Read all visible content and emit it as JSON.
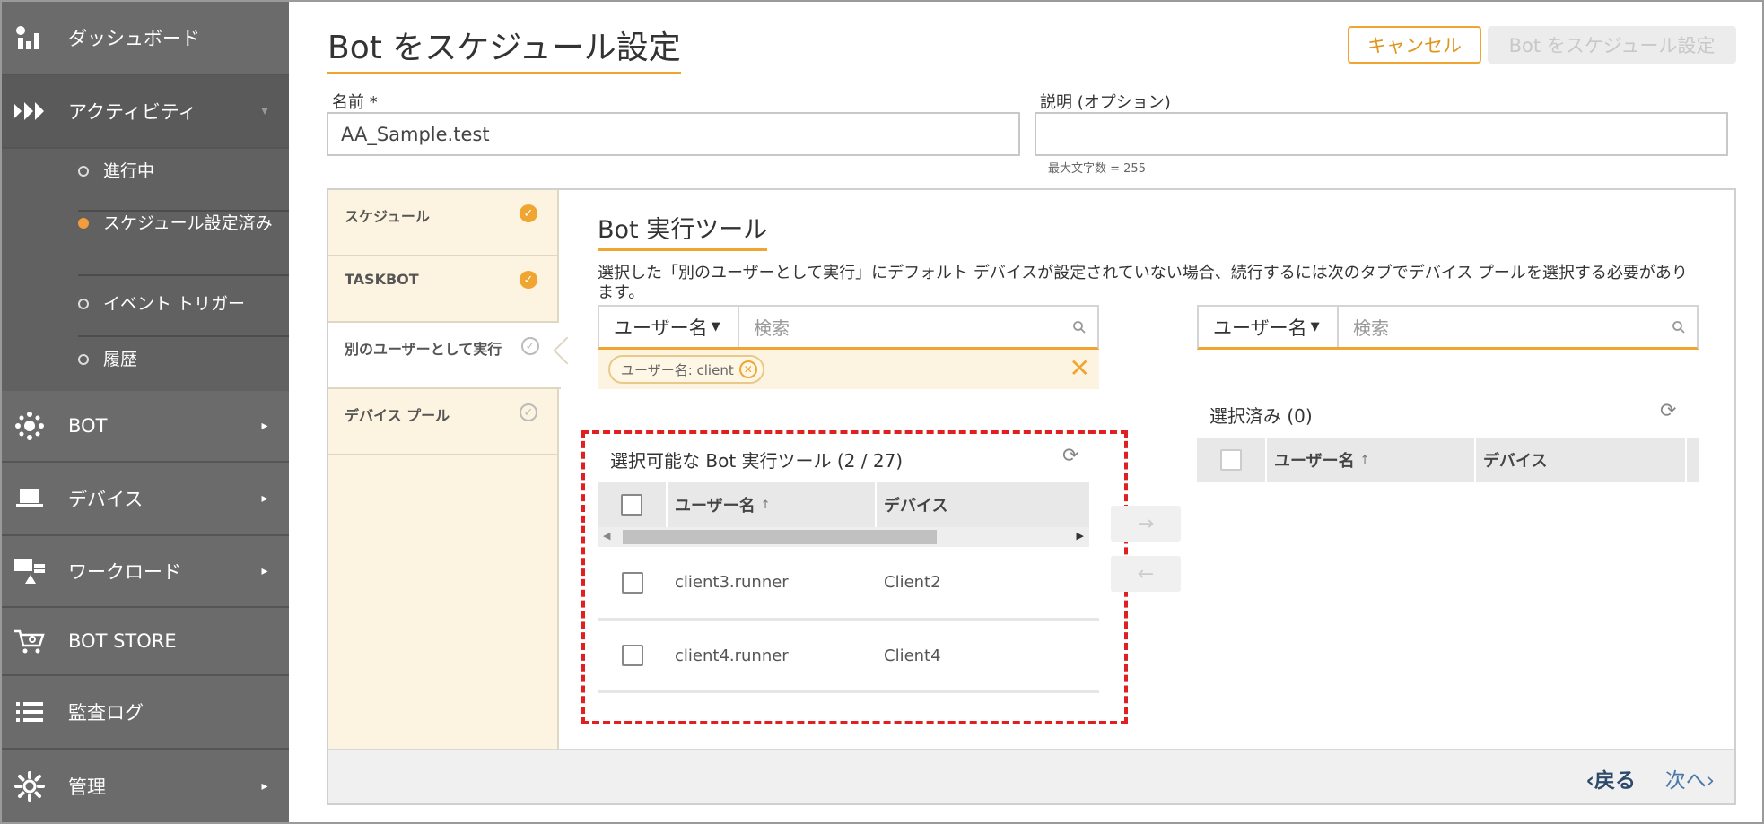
{
  "sidebar": {
    "items": [
      {
        "label": "ダッシュボード",
        "icon": "dashboard-icon"
      },
      {
        "label": "アクティビティ",
        "icon": "activity-icon"
      },
      {
        "label": "BOT",
        "icon": "bot-icon"
      },
      {
        "label": "デバイス",
        "icon": "laptop-icon"
      },
      {
        "label": "ワークロード",
        "icon": "workload-icon"
      },
      {
        "label": "BOT STORE",
        "icon": "cart-icon"
      },
      {
        "label": "監査ログ",
        "icon": "list-icon"
      },
      {
        "label": "管理",
        "icon": "gear-icon"
      }
    ],
    "subitems": [
      {
        "label": "進行中"
      },
      {
        "label": "スケジュール設定済み"
      },
      {
        "label": "イベント トリガー"
      },
      {
        "label": "履歴"
      }
    ]
  },
  "header": {
    "title": "Bot をスケジュール設定",
    "cancel_label": "キャンセル",
    "schedule_label": "Bot をスケジュール設定"
  },
  "form": {
    "name_label": "名前 *",
    "name_value": "AA_Sample.test",
    "desc_label": "説明 (オプション)",
    "desc_value": "",
    "desc_hint": "最大文字数 = 255"
  },
  "steps": [
    {
      "label": "スケジュール",
      "done": true
    },
    {
      "label": "TASKBOT",
      "done": true
    },
    {
      "label": "別のユーザーとして実行",
      "done": false
    },
    {
      "label": "デバイス プール",
      "done": false
    }
  ],
  "main": {
    "section_title": "Bot 実行ツール",
    "description": "選択した「別のユーザーとして実行」にデフォルト デバイスが設定されていない場合、続行するには次のタブでデバイス プールを選択する必要があります。",
    "left_search": {
      "field": "ユーザー名",
      "placeholder": "検索"
    },
    "right_search": {
      "field": "ユーザー名",
      "placeholder": "検索"
    },
    "filter_chip": "ユーザー名: client",
    "available_title": "選択可能な Bot 実行ツール (2 / 27)",
    "selected_title": "選択済み (0)",
    "columns": [
      "ユーザー名",
      "デバイス"
    ],
    "rows": [
      {
        "user": "client3.runner",
        "device": "Client2"
      },
      {
        "user": "client4.runner",
        "device": "Client4"
      }
    ],
    "move_right": "→",
    "move_left": "←"
  },
  "footer": {
    "back_label": "‹戻る",
    "next_label": "次へ›"
  },
  "colors": {
    "accent": "#f0a531",
    "sidebar": "#6b6b6b",
    "highlight": "#e02020"
  }
}
